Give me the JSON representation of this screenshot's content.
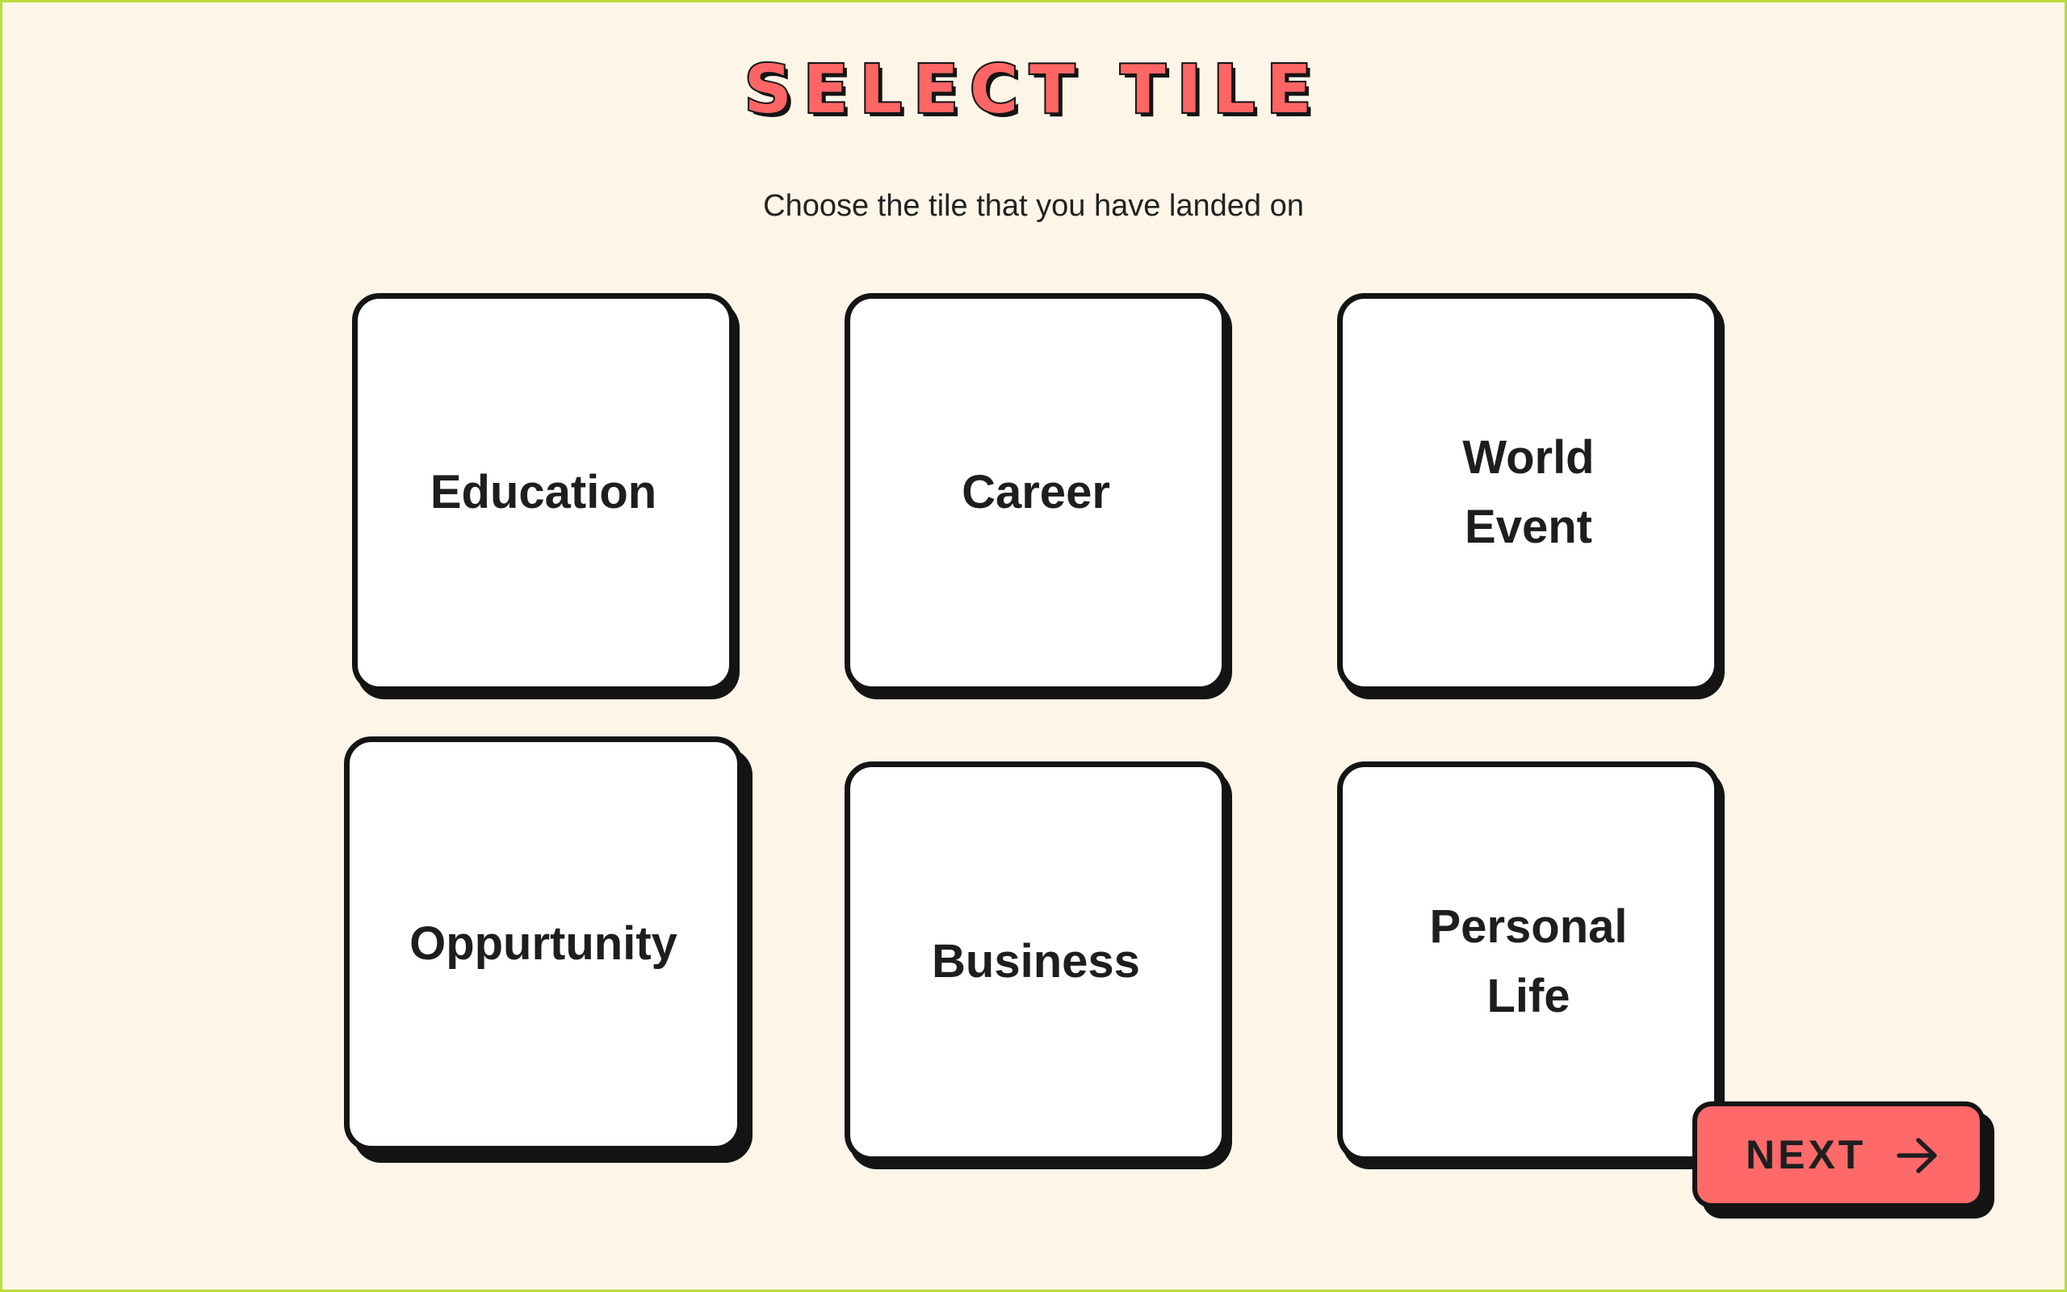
{
  "header": {
    "title": "SELECT TILE",
    "subtitle": "Choose the tile that you have landed on"
  },
  "tiles": [
    {
      "label": "Education",
      "selected": false
    },
    {
      "label": "Career",
      "selected": false
    },
    {
      "label": "World\nEvent",
      "selected": false
    },
    {
      "label": "Oppurtunity",
      "selected": true
    },
    {
      "label": "Business",
      "selected": false
    },
    {
      "label": "Personal\nLife",
      "selected": false
    }
  ],
  "next_button": {
    "label": "NEXT",
    "icon": "arrow-right-icon"
  },
  "colors": {
    "accent": "#ff6969",
    "background": "#fdf6e8",
    "outline": "#141414",
    "frame_border": "#b9dc3b"
  }
}
